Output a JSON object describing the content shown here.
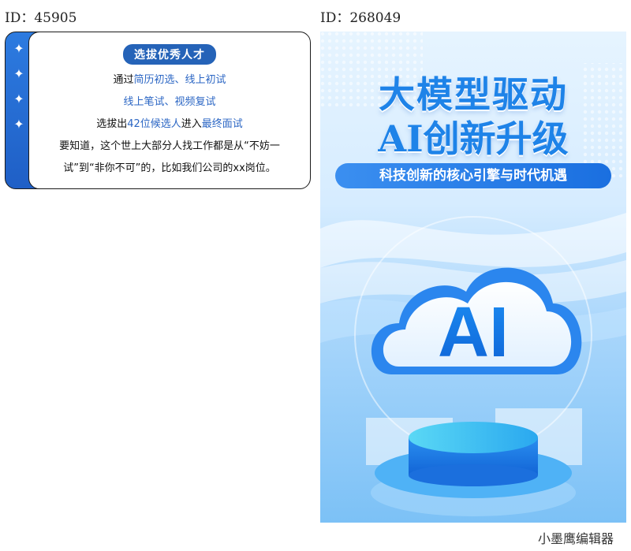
{
  "left_panel": {
    "id_label": "ID：45905",
    "pill": "选拔优秀人才",
    "line1": {
      "prefix": "通过",
      "hl": "简历初选、线上初试"
    },
    "line2": "线上笔试、视频复试",
    "line3": {
      "a": "选拔出",
      "b": "42位候选人",
      "c": "进入",
      "d": "最终面试"
    },
    "line4": "要知道，这个世上大部分人找工作都是从“不妨一",
    "line5": "试”到“非你不可”的，比如我们公司的xx岗位。",
    "tab_icons": [
      "sparkle-icon",
      "sparkle-icon",
      "sparkle-icon",
      "sparkle-icon"
    ]
  },
  "right_panel": {
    "id_label": "ID：268049",
    "title1": "大模型驱动",
    "title2": "AI创新升级",
    "banner": "科技创新的核心引擎与时代机遇",
    "cloud_text": "AI"
  },
  "watermark": "小墨鹰编辑器",
  "colors": {
    "accent": "#2563b8",
    "poster_blue": "#1e83e8",
    "card_border": "#1a1a1a"
  }
}
